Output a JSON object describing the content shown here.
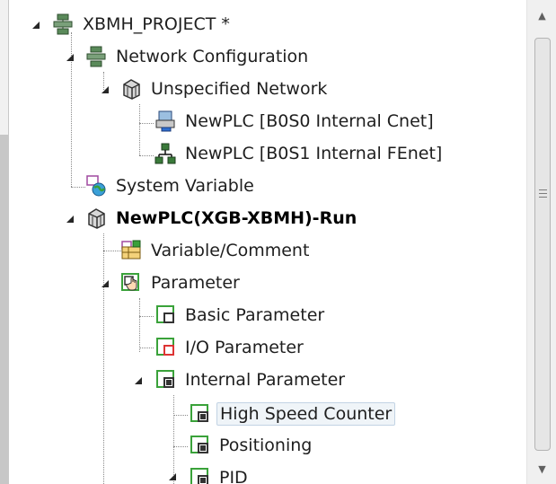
{
  "tree": {
    "project": {
      "label": "XBMH_PROJECT *"
    },
    "network_config": {
      "label": "Network Configuration"
    },
    "unspecified_network": {
      "label": "Unspecified Network"
    },
    "plc_cnet": {
      "label": "NewPLC [B0S0 Internal Cnet]"
    },
    "plc_fenet": {
      "label": "NewPLC [B0S1 Internal FEnet]"
    },
    "system_variable": {
      "label": "System Variable"
    },
    "plc_run": {
      "label": "NewPLC(XGB-XBMH)-Run"
    },
    "variable_comment": {
      "label": "Variable/Comment"
    },
    "parameter": {
      "label": "Parameter"
    },
    "basic_parameter": {
      "label": "Basic Parameter"
    },
    "io_parameter": {
      "label": "I/O Parameter"
    },
    "internal_parameter": {
      "label": "Internal Parameter"
    },
    "high_speed_counter": {
      "label": "High Speed Counter"
    },
    "positioning": {
      "label": "Positioning"
    },
    "pid": {
      "label": "PID"
    }
  },
  "scrollbar": {
    "up_arrow": "▲",
    "down_arrow": "▼"
  },
  "icons": {
    "project": "network-config-icon",
    "network": "network-config-icon",
    "unspecified": "network-cube-icon",
    "cnet": "serial-port-icon",
    "fenet": "ethernet-icon",
    "sysvar": "globe-variable-icon",
    "plc": "plc-cube-icon",
    "varcomment": "variable-table-icon",
    "parameter": "parameter-hand-icon",
    "basic": "basic-parameter-icon",
    "io": "io-parameter-icon",
    "internal": "internal-parameter-icon"
  },
  "colors": {
    "selection_bg": "#eff4f8",
    "selection_border": "#c2d3e4",
    "param_green": "#3aa23a"
  }
}
